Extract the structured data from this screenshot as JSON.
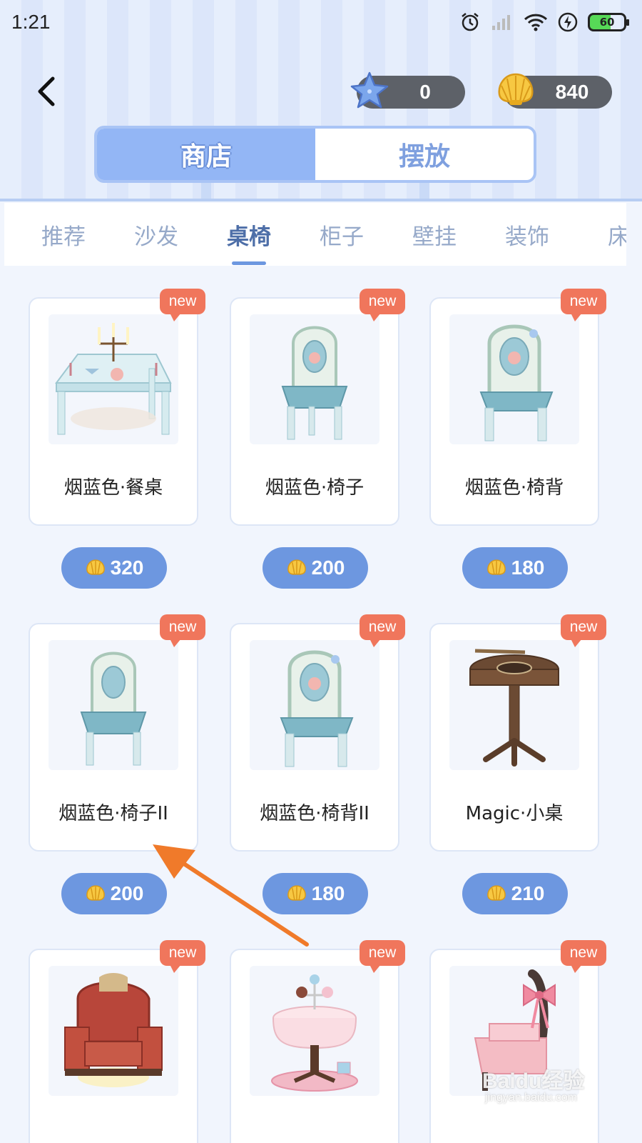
{
  "status_bar": {
    "time": "1:21",
    "battery": "60",
    "icons": [
      "alarm-icon",
      "signal-icon",
      "wifi-icon",
      "charging-icon",
      "battery-icon"
    ]
  },
  "header": {
    "back_icon": "chevron-left-icon",
    "starfish_count": "0",
    "shell_count": "840",
    "mode_tabs": [
      {
        "label": "商店",
        "active": true
      },
      {
        "label": "摆放",
        "active": false
      }
    ]
  },
  "categories": [
    {
      "label": "推荐",
      "active": false
    },
    {
      "label": "沙发",
      "active": false
    },
    {
      "label": "桌椅",
      "active": true
    },
    {
      "label": "柜子",
      "active": false
    },
    {
      "label": "壁挂",
      "active": false
    },
    {
      "label": "装饰",
      "active": false
    },
    {
      "label": "床",
      "active": false
    }
  ],
  "badge_label": "new",
  "items": [
    {
      "name": "烟蓝色·餐桌",
      "price": "320",
      "image": "dining-table-image"
    },
    {
      "name": "烟蓝色·椅子",
      "price": "200",
      "image": "chair-image"
    },
    {
      "name": "烟蓝色·椅背",
      "price": "180",
      "image": "chair-back-image"
    },
    {
      "name": "烟蓝色·椅子II",
      "price": "200",
      "image": "chair-image"
    },
    {
      "name": "烟蓝色·椅背II",
      "price": "180",
      "image": "chair-back-image"
    },
    {
      "name": "Magic·小桌",
      "price": "210",
      "image": "round-side-table-image"
    },
    {
      "name": "",
      "price": "",
      "image": "red-armchair-image"
    },
    {
      "name": "",
      "price": "",
      "image": "dessert-table-image"
    },
    {
      "name": "",
      "price": "",
      "image": "pink-bow-chair-image"
    }
  ],
  "watermark": {
    "brand": "Baidu经验",
    "url": "jingyan.baidu.com"
  },
  "colors": {
    "accent": "#6d97e0",
    "tab_active": "#93b6f5",
    "badge": "#f0765c",
    "arrow": "#f07a2a"
  }
}
